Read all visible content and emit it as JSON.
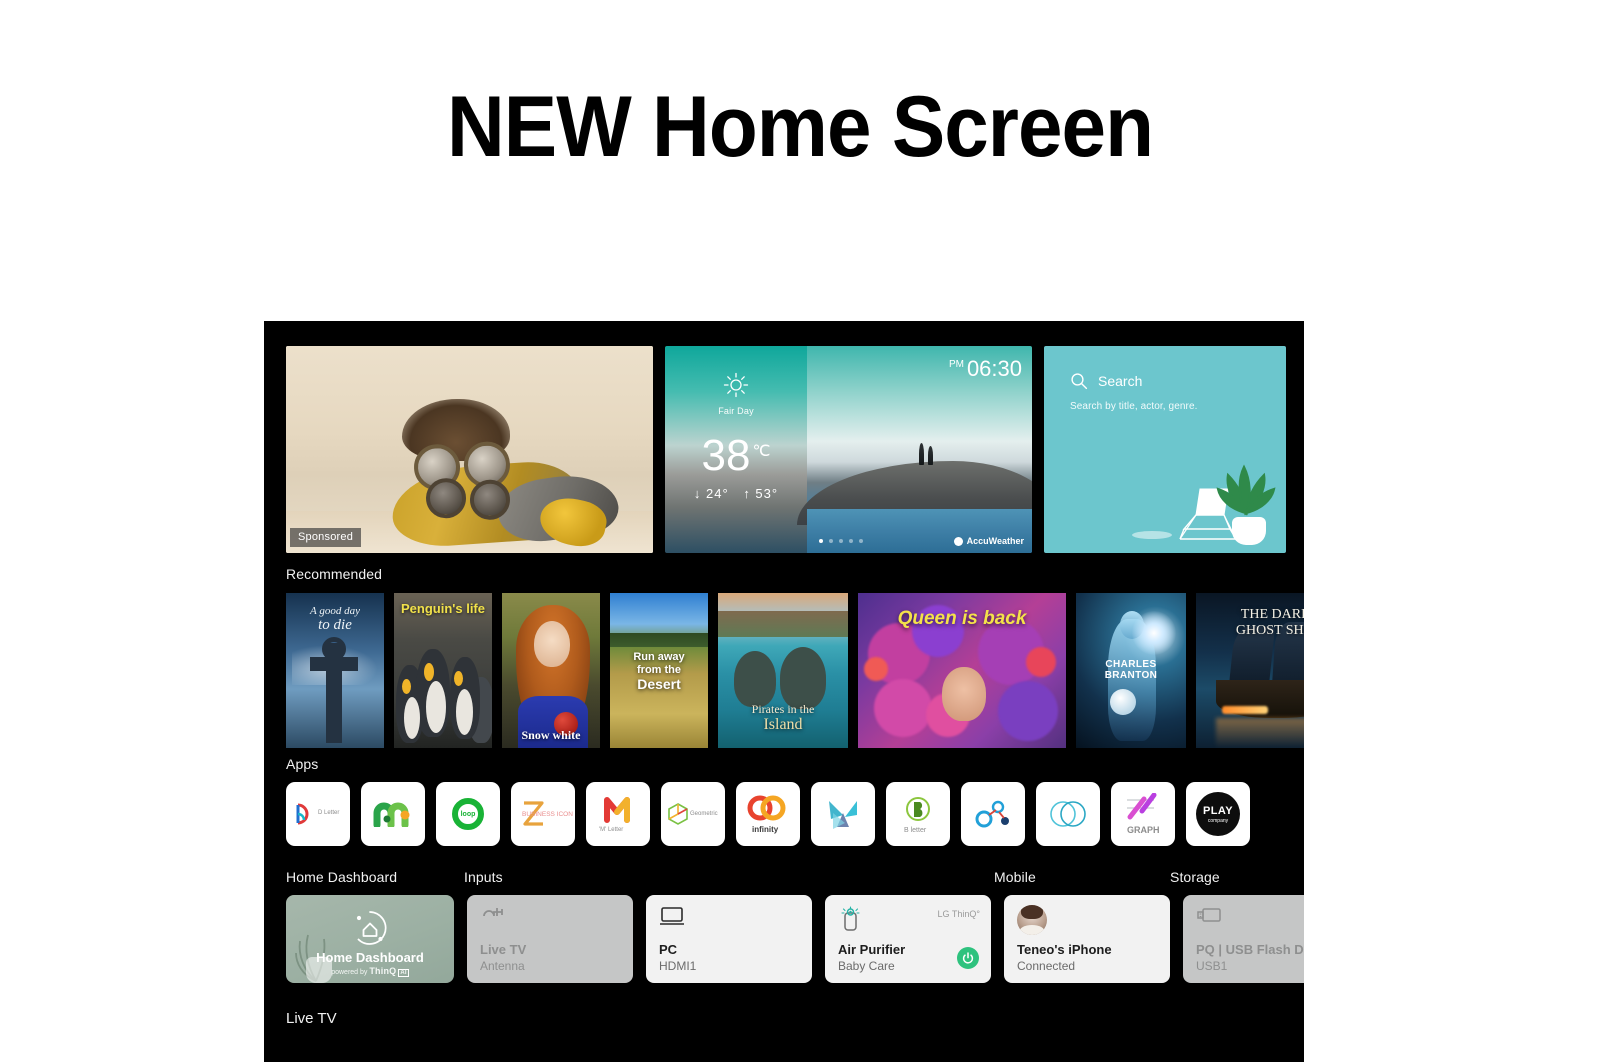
{
  "headline": "NEW Home Screen",
  "hero": {
    "ad": {
      "badge": "Sponsored"
    },
    "weather": {
      "condition": "Fair Day",
      "temperature": "38",
      "unit": "℃",
      "low": "↓ 24°",
      "high": "↑ 53°",
      "ampm": "PM",
      "time": "06:30",
      "provider": "AccuWeather",
      "dots_total": 5,
      "dots_active": 1
    },
    "search": {
      "title": "Search",
      "subtitle": "Search by title, actor, genre.",
      "icon": "search-icon",
      "bg_color": "#6cc6cd"
    }
  },
  "recommended": {
    "label": "Recommended",
    "items": [
      {
        "line1": "A good day",
        "line2": "to die"
      },
      {
        "line1": "Penguin's life"
      },
      {
        "line1": "Snow white"
      },
      {
        "line1": "Run away",
        "line2": "from the",
        "line3": "Desert"
      },
      {
        "line1": "Pirates in the",
        "line2": "Island"
      },
      {
        "line1": "Queen is back"
      },
      {
        "line1": "CHARLES BRANTON"
      },
      {
        "line1": "THE DARK",
        "line2": "GHOST SHIP"
      }
    ]
  },
  "apps": {
    "label": "Apps",
    "items": [
      {
        "name": "D Letter",
        "icon": "d-letter-icon"
      },
      {
        "name": "",
        "icon": "m-arch-icon"
      },
      {
        "name": "loop",
        "icon": "loop-ring-icon"
      },
      {
        "name": "BUSINESS ICON",
        "icon": "z-business-icon"
      },
      {
        "name": "'M' Letter",
        "icon": "m-letter-icon"
      },
      {
        "name": "Geometric",
        "icon": "geometric-cube-icon"
      },
      {
        "name": "infinity",
        "icon": "infinity-rings-icon"
      },
      {
        "name": "",
        "icon": "bird-leaf-icon"
      },
      {
        "name": "B letter",
        "icon": "b-letter-icon"
      },
      {
        "name": "",
        "icon": "molecule-icon"
      },
      {
        "name": "",
        "icon": "double-circle-icon"
      },
      {
        "name": "GRAPH",
        "icon": "graph-icon"
      },
      {
        "name": "PLAY",
        "icon": "play-company-icon"
      }
    ]
  },
  "dashboard": {
    "group_labels": {
      "home": "Home Dashboard",
      "inputs": "Inputs",
      "mobile": "Mobile",
      "storage": "Storage"
    },
    "home_tile": {
      "title": "Home Dashboard",
      "powered_prefix": "powered by ",
      "powered_brand": "ThinQ",
      "powered_ai": "AI",
      "bg_color": "#9fb2a6"
    },
    "tiles": [
      {
        "name": "Live TV",
        "sub": "Antenna",
        "icon": "antenna-input-icon",
        "state": "dim"
      },
      {
        "name": "PC",
        "sub": "HDMI1",
        "icon": "monitor-icon",
        "state": "light"
      },
      {
        "name": "Air Purifier",
        "sub": "Baby Care",
        "icon": "air-purifier-icon",
        "state": "light",
        "brand": "LG ThinQ°",
        "power": "power-on"
      },
      {
        "name": "Teneo's iPhone",
        "sub": "Connected",
        "icon": "avatar",
        "state": "light"
      },
      {
        "name": "PQ | USB Flash Drive",
        "sub": "USB1",
        "icon": "usb-icon",
        "state": "dim"
      }
    ]
  },
  "bottom": {
    "label": "Live TV"
  }
}
